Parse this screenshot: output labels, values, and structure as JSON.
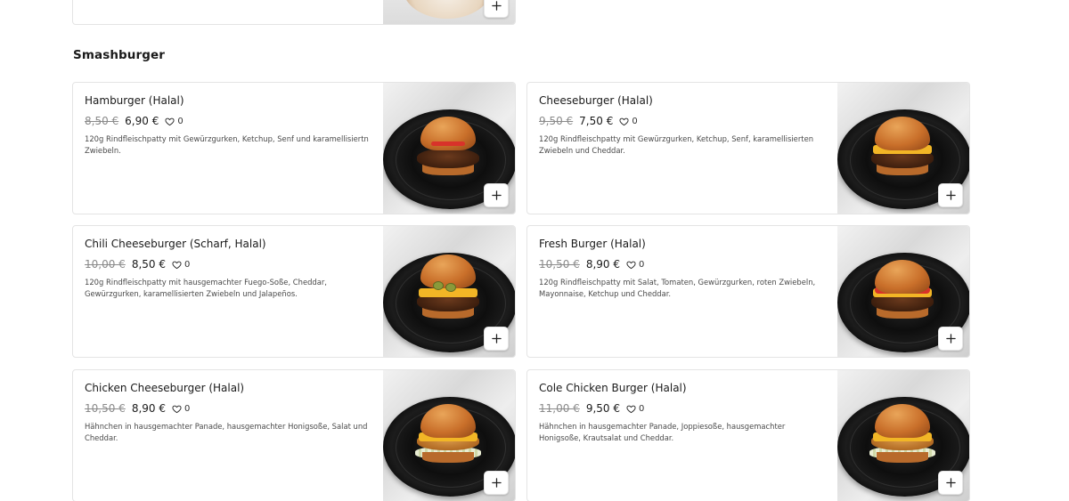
{
  "section": {
    "title": "Smashburger"
  },
  "products": [
    {
      "name": "Hamburger (Halal)",
      "old_price": "8,50 €",
      "price": "6,90 €",
      "favorites": "0",
      "description": "120g Rindfleischpatty mit Gewürzgurken, Ketchup, Senf und karamellisiertn Zwiebeln.",
      "variant": "classic"
    },
    {
      "name": "Cheeseburger (Halal)",
      "old_price": "9,50 €",
      "price": "7,50 €",
      "favorites": "0",
      "description": "120g Rindfleischpatty mit Gewürzgurken, Ketchup, Senf, karamellisierten Zwiebeln und Cheddar.",
      "variant": "cheese"
    },
    {
      "name": "Chili Cheeseburger (Scharf, Halal)",
      "old_price": "10,00 €",
      "price": "8,50 €",
      "favorites": "0",
      "description": "120g Rindfleischpatty mit hausgemachter Fuego-Soße, Cheddar, Gewürzgurken, karamellisierten Zwiebeln und Jalapeños.",
      "variant": "chili"
    },
    {
      "name": "Fresh Burger (Halal)",
      "old_price": "10,50 €",
      "price": "8,90 €",
      "favorites": "0",
      "description": "120g Rindfleischpatty mit Salat, Tomaten, Gewürzgurken, roten Zwiebeln, Mayonnaise, Ketchup und Cheddar.",
      "variant": "fresh"
    },
    {
      "name": "Chicken Cheeseburger (Halal)",
      "old_price": "10,50 €",
      "price": "8,90 €",
      "favorites": "0",
      "description": "Hähnchen in hausgemachter Panade, hausgemachter Honigsoße, Salat und Cheddar.",
      "variant": "chicken"
    },
    {
      "name": "Cole Chicken Burger (Halal)",
      "old_price": "11,00 €",
      "price": "9,50 €",
      "favorites": "0",
      "description": "Hähnchen in hausgemachter Panade, Joppiesoße, hausgemachter Honigsoße, Krautsalat und Cheddar.",
      "variant": "cole"
    }
  ],
  "icons": {
    "favorite": "heart-outline-icon",
    "add": "plus-icon"
  }
}
